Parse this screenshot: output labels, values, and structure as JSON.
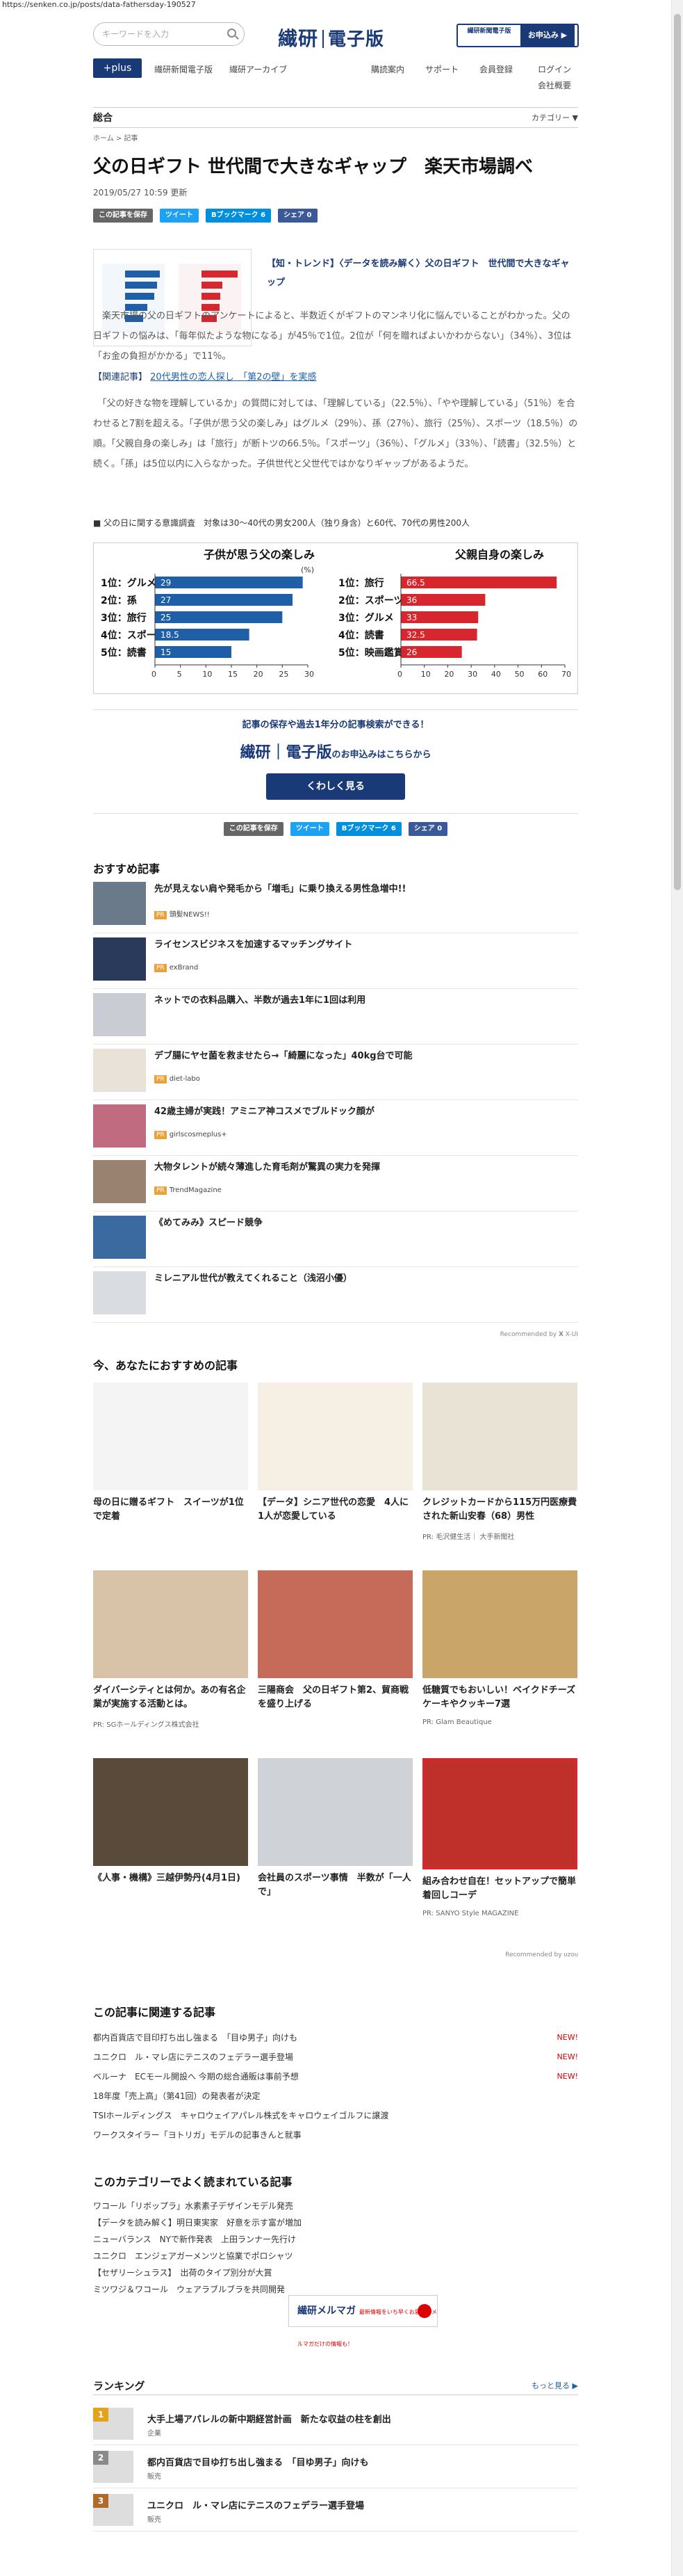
{
  "url": "https://senken.co.jp/posts/data-fathersday-190527",
  "header": {
    "search_placeholder": "キーワードを入力",
    "logo_main": "繊研",
    "logo_sub": "電子版",
    "promo_left": "繊研新聞電子版",
    "promo_right": "お申込み ▶",
    "plus_label": "+plus",
    "nav_left": [
      "繊研新聞電子版",
      "繊研アーカイブ"
    ],
    "nav_right": [
      "購読案内",
      "サポート",
      "会員登録",
      "ログイン"
    ],
    "nav_more": "会社概要",
    "category": "総合",
    "category_dropdown": "カテゴリー ▼"
  },
  "article": {
    "breadcrumb": "ホーム > 記事",
    "title": "父の日ギフト 世代間で大きなギャップ　楽天市場調べ",
    "date": "2019/05/27 10:59 更新",
    "share": {
      "save": "この記事を保存",
      "tweet": "ツイート",
      "hatena": "Bブックマーク 6",
      "fb": "シェア 0"
    },
    "lead": "【知・トレンド】〈データを読み解く〉父の日ギフト　世代間で大きなギャップ",
    "p1": "　楽天市場の父の日ギフトのアンケートによると、半数近くがギフトのマンネリ化に悩んでいることがわかった。父の日ギフトの悩みは、「毎年似たような物になる」が45％で1位。2位が「何を贈ればよいかわからない」（34％）、3位は「お金の負担がかかる」で11％。",
    "related_label": "【関連記事】",
    "related_link": "20代男性の恋人探し　「第2の壁」を実感",
    "p2": "　「父の好きな物を理解しているか」の質問に対しては、「理解している」（22.5％）、「やや理解している」（51％）を合わせると7割を超える。「子供が思う父の楽しみ」はグルメ（29％）、孫（27％）、旅行（25％）、スポーツ（18.5％）の順。「父親自身の楽しみ」は「旅行」が断トツの66.5％。「スポーツ」（36％）、「グルメ」（33％）、「読書」（32.5％）と続く。「孫」は5位以内に入らなかった。子供世代と父世代ではかなりギャップがあるようだ。",
    "survey_note": "■ 父の日に関する意識調査　対象は30〜40代の男女200人（独り身含）と60代、70代の男性200人"
  },
  "chart_data": [
    {
      "type": "bar",
      "title": "子供が思う父の楽しみ",
      "categories": [
        "1位：グルメ",
        "2位：孫",
        "3位：旅行",
        "4位：スポーツ",
        "5位：読書"
      ],
      "values": [
        29,
        27,
        25,
        18.5,
        15
      ],
      "xlim": [
        0,
        30
      ],
      "xticks": [
        0,
        5,
        10,
        15,
        20,
        25,
        30
      ],
      "unit": "(%)",
      "color": "#1e5fa8"
    },
    {
      "type": "bar",
      "title": "父親自身の楽しみ",
      "categories": [
        "1位：旅行",
        "2位：スポーツ",
        "3位：グルメ",
        "4位：読書",
        "5位：映画鑑賞"
      ],
      "values": [
        66.5,
        36,
        33,
        32.5,
        26
      ],
      "xlim": [
        0,
        70
      ],
      "xticks": [
        0,
        10,
        20,
        30,
        40,
        50,
        60,
        70
      ],
      "color": "#d8262e"
    }
  ],
  "promo": {
    "line1": "記事の保存や過去1年分の記事検索ができる！",
    "logo": "繊研｜電子版",
    "line2": "のお申込みはこちらから",
    "button": "くわしく見る"
  },
  "recommended": {
    "title": "おすすめ記事",
    "items": [
      {
        "title": "先が見えない肩や発毛から「増毛」に乗り換える男性急増中!!",
        "source": "頭髪NEWS!!"
      },
      {
        "title": "ライセンスビジネスを加速するマッチングサイト",
        "source": "exBrand"
      },
      {
        "title": "ネットでの衣料品購入、半数が過去1年に1回は利用",
        "source": ""
      },
      {
        "title": "デブ腸にヤセ菌を救ませたら→「綺麗になった」40kg台で可能",
        "source": "diet-labo"
      },
      {
        "title": "42歳主婦が実践！アミニア神コスメでブルドック顔が",
        "source": "girlscosmeplus+"
      },
      {
        "title": "大物タレントが続々薄進した育毛剤が驚異の実力を発揮",
        "source": "TrendMagazine"
      },
      {
        "title": "《めてみみ》スピード競争",
        "source": ""
      },
      {
        "title": "ミレニアル世代が教えてくれること（浅沼小優）",
        "source": ""
      }
    ],
    "recommended_by": "Recommended by 𝗫 X-UI"
  },
  "for_you": {
    "title": "今、あなたにおすすめの記事",
    "cards": [
      {
        "title": "母の日に贈るギフト　スイーツが1位で定着",
        "source": ""
      },
      {
        "title": "【データ】シニア世代の恋愛　4人に1人が恋愛している",
        "source": ""
      },
      {
        "title": "クレジットカードから115万円医療費された新山安春（68）男性",
        "source": "PR: 毛沢健生活｜ 大手新聞社"
      },
      {
        "title": "ダイバーシティとは何か。あの有名企業が実施する活動とは。",
        "source": "PR: SGホールディングス株式会社"
      },
      {
        "title": "三陽商会　父の日ギフト第2、貿商戦を盛り上げる",
        "source": ""
      },
      {
        "title": "低糖質でもおいしい！ベイクドチーズケーキやクッキー7選",
        "source": "PR: Glam Beautique"
      },
      {
        "title": "《人事・機構》三越伊勢丹(4月1日)",
        "source": ""
      },
      {
        "title": "会社員のスポーツ事情　半数が「一人で」",
        "source": ""
      },
      {
        "title": "組み合わせ自在！セットアップで簡単着回しコーデ",
        "source": "PR: SANYO Style MAGAZINE"
      }
    ],
    "recommended_by": "Recommended by ᴜᴢᴏᴜ"
  },
  "related": {
    "title": "この記事に関連する記事",
    "new_label": "NEW!",
    "items": [
      "都内百貨店で目印打ち出し強まる　「目ゆ男子」向けも",
      "ユニクロ　ル・マレ店にテニスのフェデラー選手登場",
      "ベルーナ　ECモール開設へ 今期の総合通販は事前予想",
      "18年度「売上高」（第41回）の発表者が決定",
      "TSIホールディングス　キャロウェイアパレル株式をキャロウェイゴルフに譲渡",
      "ワークスタイラー「ヨトリガ」モデルの記事きんと就事"
    ]
  },
  "popular": {
    "title": "このカテゴリーでよく読まれている記事",
    "items": [
      "ワコール「リボップラ」水素素子デザインモデル発売",
      "【データを読み解く】明日東実家　好意を示す富が増加",
      "ニューバランス　NYで新作発表　上田ランナー先行け",
      "ユニクロ　エンジェアガーメンツと協業でポロシャツ",
      "【セザリーシュラス】　出荷のタイプ別分が大賞",
      "ミツワジ＆ワコール　ウェアラブルブラを共同開発"
    ]
  },
  "magazine": {
    "label": "繊研メルマガ",
    "note": "最新情報をいち早くお届け！メルマガだけの情報も！"
  },
  "ranking": {
    "title": "ランキング",
    "more": "もっと見る ▶",
    "items": [
      {
        "rank": "1",
        "title": "大手上場アパレルの新中期経営計画　新たな収益の柱を創出",
        "source": "企業"
      },
      {
        "rank": "2",
        "title": "都内百貨店で目ゆ打ち出し強まる　「目ゆ男子」向けも",
        "source": "販売"
      },
      {
        "rank": "3",
        "title": "ユニクロ　ル・マレ店にテニスのフェデラー選手登場",
        "source": "販売"
      }
    ]
  },
  "colors": {
    "brand": "#1a3a77",
    "red": "#d8262e",
    "blue": "#1e5fa8"
  }
}
